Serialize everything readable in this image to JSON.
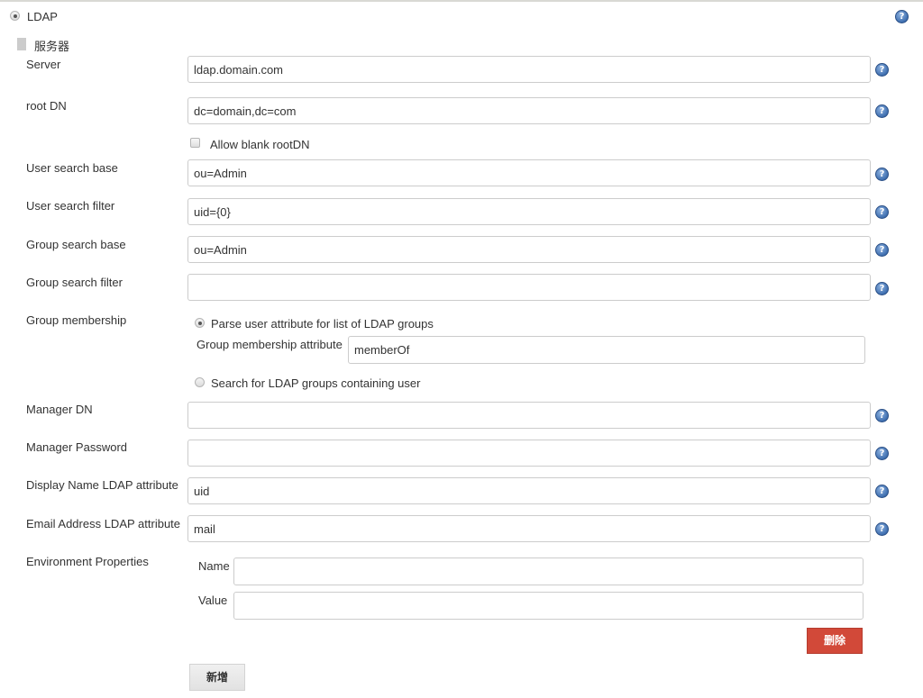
{
  "security_realm": {
    "label": "LDAP",
    "selected": true
  },
  "server_section": {
    "title": "服务器"
  },
  "fields": {
    "server": {
      "label": "Server",
      "value": "ldap.domain.com",
      "placeholder": ""
    },
    "root_dn": {
      "label": "root DN",
      "value": "dc=domain,dc=com",
      "placeholder": ""
    },
    "allow_blank_rootdn": {
      "label": "Allow blank rootDN",
      "checked": false
    },
    "user_search_base": {
      "label": "User search base",
      "value": "ou=Admin",
      "placeholder": ""
    },
    "user_search_filter": {
      "label": "User search filter",
      "value": "uid={0}",
      "placeholder": ""
    },
    "group_search_base": {
      "label": "Group search base",
      "value": "ou=Admin",
      "placeholder": ""
    },
    "group_search_filter": {
      "label": "Group search filter",
      "value": "",
      "placeholder": ""
    },
    "group_membership": {
      "label": "Group membership",
      "option_parse": {
        "label": "Parse user attribute for list of LDAP groups",
        "selected": true
      },
      "attribute_label": "Group membership attribute",
      "attribute_value": "memberOf",
      "option_search": {
        "label": "Search for LDAP groups containing user",
        "selected": false
      }
    },
    "manager_dn": {
      "label": "Manager DN",
      "value": "",
      "placeholder": ""
    },
    "manager_password": {
      "label": "Manager Password",
      "value": "",
      "placeholder": ""
    },
    "display_name_attr": {
      "label": "Display Name LDAP attribute",
      "value": "uid",
      "placeholder": ""
    },
    "email_attr": {
      "label": "Email Address LDAP attribute",
      "value": "mail",
      "placeholder": ""
    },
    "environment_properties": {
      "label": "Environment Properties",
      "name_label": "Name",
      "name_value": "",
      "value_label": "Value",
      "value_value": ""
    }
  },
  "buttons": {
    "delete": "删除",
    "add": "新增"
  },
  "icons": {
    "help": "?"
  },
  "colors": {
    "delete_button": "#d24939",
    "help_icon": "#3f6fb0",
    "text": "#333333"
  }
}
